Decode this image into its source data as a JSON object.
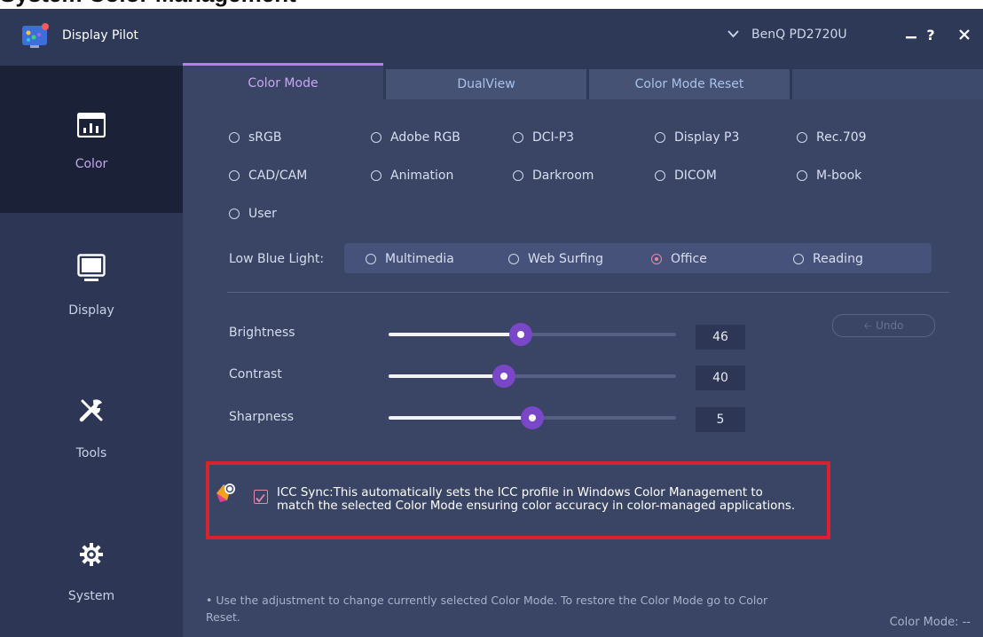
{
  "top_strip_text": "System Color Management",
  "app": {
    "title": "Display Pilot",
    "monitor": "BenQ PD2720U",
    "help_label": "?"
  },
  "sidebar": {
    "items": [
      {
        "label": "Color",
        "icon": "color-chart-icon"
      },
      {
        "label": "Display",
        "icon": "monitor-icon"
      },
      {
        "label": "Tools",
        "icon": "tools-icon"
      },
      {
        "label": "System",
        "icon": "gear-icon"
      }
    ]
  },
  "tabs": [
    {
      "label": "Color Mode"
    },
    {
      "label": "DualView"
    },
    {
      "label": "Color Mode Reset"
    }
  ],
  "color_modes": [
    "sRGB",
    "Adobe RGB",
    "DCI-P3",
    "Display P3",
    "Rec.709",
    "CAD/CAM",
    "Animation",
    "Darkroom",
    "DICOM",
    "M-book",
    "User"
  ],
  "low_blue_light": {
    "label": "Low Blue Light:",
    "options": [
      "Multimedia",
      "Web Surfing",
      "Office",
      "Reading"
    ],
    "selected": "Office"
  },
  "sliders": {
    "brightness": {
      "label": "Brightness",
      "value": "46"
    },
    "contrast": {
      "label": "Contrast",
      "value": "40"
    },
    "sharpness": {
      "label": "Sharpness",
      "value": "5"
    }
  },
  "undo_label": "Undo",
  "icc_sync": {
    "checked": true,
    "text": "ICC Sync:This automatically sets the ICC profile in Windows Color Management to match the selected Color Mode ensuring color accuracy in color-managed applications."
  },
  "footnote": "• Use the adjustment to change currently selected Color Mode. To restore the Color Mode go to Color Reset.",
  "color_mode_status": "Color Mode: --",
  "colors": {
    "accent": "#b37ff2",
    "highlight_border": "#d7232f",
    "sidebar_active_bg": "#1b2136",
    "panel_bg": "#3a4565"
  }
}
